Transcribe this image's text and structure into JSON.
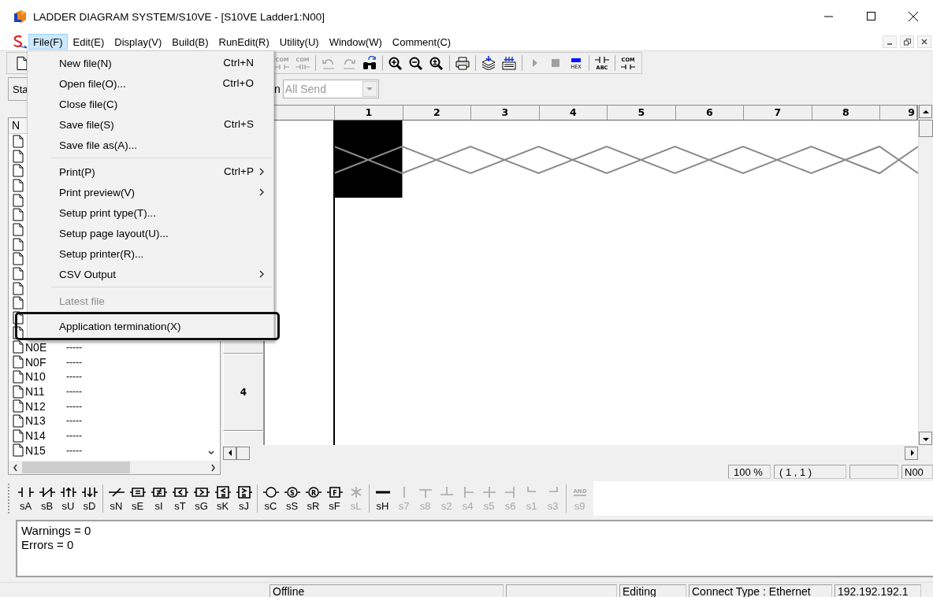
{
  "window": {
    "title": "LADDER DIAGRAM SYSTEM/S10VE - [S10VE Ladder1:N00]"
  },
  "menu_bar": [
    {
      "label": "File(F)",
      "selected": true
    },
    {
      "label": "Edit(E)",
      "selected": false
    },
    {
      "label": "Display(V)",
      "selected": false
    },
    {
      "label": "Build(B)",
      "selected": false
    },
    {
      "label": "RunEdit(R)",
      "selected": false
    },
    {
      "label": "Utility(U)",
      "selected": false
    },
    {
      "label": "Window(W)",
      "selected": false
    },
    {
      "label": "Comment(C)",
      "selected": false
    }
  ],
  "file_menu": [
    {
      "kind": "item",
      "label": "New file(N)",
      "shortcut": "Ctrl+N",
      "submenu": false,
      "disabled": false,
      "highlighted": false
    },
    {
      "kind": "item",
      "label": "Open file(O)...",
      "shortcut": "Ctrl+O",
      "submenu": false,
      "disabled": false,
      "highlighted": false
    },
    {
      "kind": "item",
      "label": "Close file(C)",
      "submenu": false,
      "disabled": false,
      "highlighted": false
    },
    {
      "kind": "item",
      "label": "Save file(S)",
      "shortcut": "Ctrl+S",
      "submenu": false,
      "disabled": false,
      "highlighted": false
    },
    {
      "kind": "item",
      "label": "Save file as(A)...",
      "submenu": false,
      "disabled": false,
      "highlighted": false
    },
    {
      "kind": "separator"
    },
    {
      "kind": "item",
      "label": "Print(P)",
      "shortcut": "Ctrl+P",
      "submenu": true,
      "disabled": false,
      "highlighted": false
    },
    {
      "kind": "item",
      "label": "Print preview(V)",
      "submenu": true,
      "disabled": false,
      "highlighted": false
    },
    {
      "kind": "item",
      "label": "Setup print type(T)...",
      "submenu": false,
      "disabled": false,
      "highlighted": false
    },
    {
      "kind": "item",
      "label": "Setup page layout(U)...",
      "submenu": false,
      "disabled": false,
      "highlighted": false
    },
    {
      "kind": "item",
      "label": "Setup printer(R)...",
      "submenu": false,
      "disabled": false,
      "highlighted": false
    },
    {
      "kind": "item",
      "label": "CSV Output",
      "submenu": true,
      "disabled": false,
      "highlighted": false
    },
    {
      "kind": "separator"
    },
    {
      "kind": "item",
      "label": "Latest file",
      "submenu": false,
      "disabled": true,
      "highlighted": false
    },
    {
      "kind": "separator"
    },
    {
      "kind": "item",
      "label": "Application termination(X)",
      "submenu": false,
      "disabled": false,
      "highlighted": true
    }
  ],
  "toolbar": [
    {
      "kind": "new",
      "disabled": false
    },
    {
      "kind": "gap"
    },
    {
      "kind": "com",
      "caption": "COM",
      "disabled": true
    },
    {
      "kind": "com2",
      "caption": "COM",
      "disabled": true
    },
    {
      "kind": "sep"
    },
    {
      "kind": "undo",
      "disabled": true
    },
    {
      "kind": "redo",
      "disabled": true
    },
    {
      "kind": "find",
      "disabled": false
    },
    {
      "kind": "sep"
    },
    {
      "kind": "zoom-in",
      "disabled": false
    },
    {
      "kind": "zoom-out",
      "disabled": false
    },
    {
      "kind": "zoom-fit",
      "disabled": false
    },
    {
      "kind": "sep"
    },
    {
      "kind": "print",
      "disabled": false
    },
    {
      "kind": "sep"
    },
    {
      "kind": "download",
      "disabled": false
    },
    {
      "kind": "download-all",
      "disabled": false
    },
    {
      "kind": "sep"
    },
    {
      "kind": "run",
      "disabled": true
    },
    {
      "kind": "stop",
      "disabled": true
    },
    {
      "kind": "hex",
      "caption": "HEX",
      "disabled": false
    },
    {
      "kind": "sep"
    },
    {
      "kind": "abc",
      "caption": "ABC",
      "disabled": false
    },
    {
      "kind": "sep"
    },
    {
      "kind": "com3",
      "caption": "COM",
      "disabled": false
    }
  ],
  "send_bar": {
    "button": "Sta",
    "label": "n",
    "combo": {
      "value": "All Send",
      "disabled": true
    }
  },
  "node_list": {
    "header": "N",
    "rows": [
      {
        "kind": "covered"
      },
      {
        "kind": "covered"
      },
      {
        "kind": "covered"
      },
      {
        "kind": "covered"
      },
      {
        "kind": "covered"
      },
      {
        "kind": "covered"
      },
      {
        "kind": "covered"
      },
      {
        "kind": "covered"
      },
      {
        "kind": "covered"
      },
      {
        "kind": "covered"
      },
      {
        "kind": "covered"
      },
      {
        "kind": "covered"
      },
      {
        "kind": "covered"
      },
      {
        "kind": "covered"
      },
      {
        "kind": "entry",
        "name": "N0E",
        "value": "-----"
      },
      {
        "kind": "entry",
        "name": "N0F",
        "value": "-----"
      },
      {
        "kind": "entry",
        "name": "N10",
        "value": "-----"
      },
      {
        "kind": "entry",
        "name": "N11",
        "value": "-----"
      },
      {
        "kind": "entry",
        "name": "N12",
        "value": "-----"
      },
      {
        "kind": "entry",
        "name": "N13",
        "value": "-----"
      },
      {
        "kind": "entry",
        "name": "N14",
        "value": "-----"
      },
      {
        "kind": "entry",
        "name": "N15",
        "value": "-----"
      }
    ]
  },
  "grid": {
    "columns": [
      {
        "label": "1",
        "selected": true
      },
      {
        "label": "2",
        "selected": false
      },
      {
        "label": "3",
        "selected": false
      },
      {
        "label": "4",
        "selected": false
      },
      {
        "label": "5",
        "selected": false
      },
      {
        "label": "6",
        "selected": false
      },
      {
        "label": "7",
        "selected": false
      },
      {
        "label": "8",
        "selected": false
      },
      {
        "label": "9",
        "selected": false
      }
    ],
    "rows": [
      {
        "kind": "covered"
      },
      {
        "kind": "label",
        "label": "4"
      },
      {
        "kind": "blank"
      }
    ]
  },
  "position_bar": {
    "zoom": "100 %",
    "position": "( 1 , 1 )",
    "node": "N00"
  },
  "palette": [
    [
      {
        "kind": "no",
        "label": "sA",
        "disabled": false
      },
      {
        "kind": "nc",
        "label": "sB",
        "disabled": false
      },
      {
        "kind": "up",
        "label": "sU",
        "disabled": false
      },
      {
        "kind": "down",
        "label": "sD",
        "disabled": false
      }
    ],
    [
      {
        "kind": "not",
        "label": "sN",
        "disabled": false
      },
      {
        "kind": "eq",
        "label": "sE",
        "disabled": false
      },
      {
        "kind": "ne",
        "label": "sI",
        "disabled": false
      },
      {
        "kind": "lt",
        "label": "sT",
        "disabled": false
      },
      {
        "kind": "gt",
        "label": "sG",
        "disabled": false
      },
      {
        "kind": "le",
        "label": "sK",
        "disabled": false
      },
      {
        "kind": "ge",
        "label": "sJ",
        "disabled": false
      }
    ],
    [
      {
        "kind": "coil",
        "label": "sC",
        "disabled": false
      },
      {
        "kind": "ring",
        "glyph": "S",
        "label": "sS",
        "disabled": false
      },
      {
        "kind": "ring",
        "glyph": "R",
        "label": "sR",
        "disabled": false
      },
      {
        "kind": "square",
        "glyph": "F",
        "label": "sF",
        "disabled": false
      },
      {
        "kind": "star",
        "label": "sL",
        "disabled": true
      }
    ],
    [
      {
        "kind": "hline",
        "label": "sH",
        "disabled": false
      },
      {
        "kind": "vline",
        "label": "s7",
        "disabled": true
      },
      {
        "kind": "tee-down",
        "label": "s8",
        "disabled": true
      },
      {
        "kind": "tee-up",
        "label": "s2",
        "disabled": true
      },
      {
        "kind": "tee-right",
        "label": "s4",
        "disabled": true
      },
      {
        "kind": "cross",
        "label": "s5",
        "disabled": true
      },
      {
        "kind": "tee-left",
        "label": "s6",
        "disabled": true
      },
      {
        "kind": "corner-l",
        "label": "s1",
        "disabled": true
      },
      {
        "kind": "corner-r",
        "label": "s3",
        "disabled": true
      }
    ],
    [
      {
        "kind": "and",
        "glyph": "AND",
        "label": "s9",
        "disabled": true
      }
    ]
  ],
  "output": {
    "lines": [
      "Warnings = 0",
      "Errors = 0"
    ]
  },
  "status_bar": {
    "mode": "Offline",
    "edit_state": "Editing",
    "connection": "Connect Type : Ethernet",
    "address": "192.192.192.1"
  }
}
